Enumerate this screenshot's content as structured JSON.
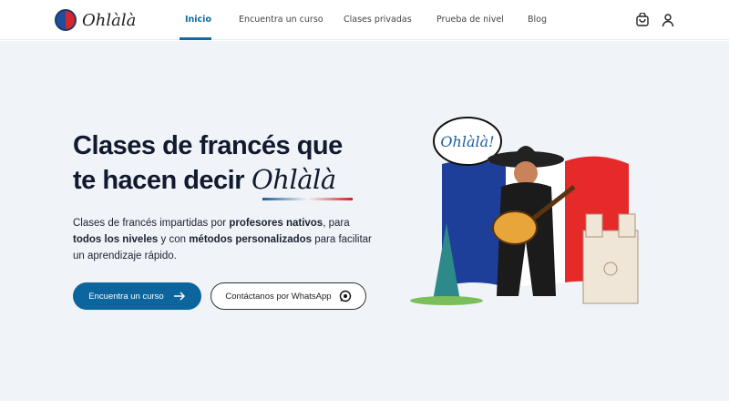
{
  "brand": {
    "name": "Ohlàlà"
  },
  "nav": {
    "items": [
      {
        "label": "Inicio",
        "active": true
      },
      {
        "label": "Encuentra un curso"
      },
      {
        "label": "Clases privadas"
      },
      {
        "label": "Prueba de nivel"
      },
      {
        "label": "Blog"
      }
    ]
  },
  "hero": {
    "title_line1": "Clases de francés que",
    "title_line2": "te hacen decir",
    "title_script": "Ohlàlà",
    "desc_parts": [
      "Clases de francés impartidas por ",
      "profesores nativos",
      ", para ",
      "todos los niveles",
      " y con ",
      "métodos personalizados",
      " para facilitar un aprendizaje rápido."
    ],
    "cta_primary": "Encuentra un curso",
    "cta_secondary": "Contáctanos por WhatsApp",
    "bubble": "Ohlàlà!"
  },
  "colors": {
    "primary": "#0d659e",
    "flag_blue": "#1d3f9a",
    "flag_red": "#e62a2a",
    "hero_bg": "#f0f4f8"
  }
}
